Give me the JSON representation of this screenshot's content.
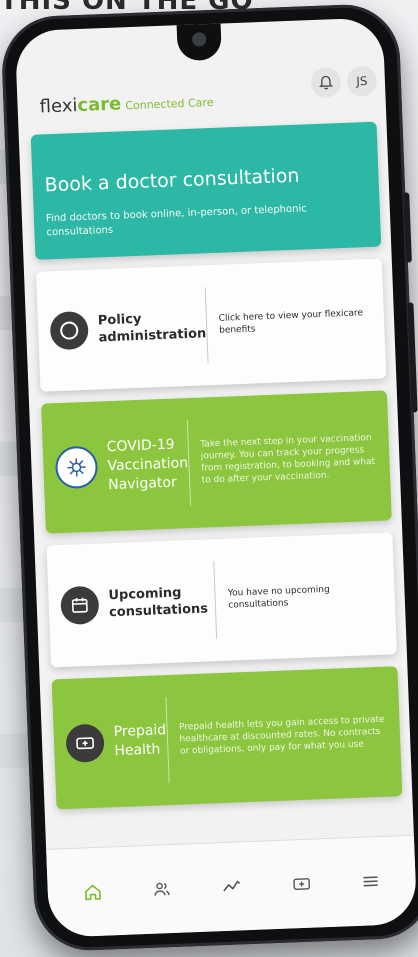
{
  "background": {
    "heading": "THIS ON THE GO"
  },
  "header": {
    "logo_prefix": "flexi",
    "logo_brand": "care",
    "logo_tagline": "Connected Care",
    "avatar_initials": "JS",
    "notification_icon": "bell-icon"
  },
  "hero": {
    "title": "Book a doctor consultation",
    "subtitle": "Find doctors to book online, in-person, or telephonic consultations"
  },
  "cards": [
    {
      "title": "Policy administration",
      "description": "Click here to view your flexicare benefits",
      "icon": "circle-icon",
      "style": "white"
    },
    {
      "title": "COVID-19 Vaccination Navigator",
      "description": "Take the next step in your vaccination journey. You can track your progress from registration, to booking and what to do after your vaccination.",
      "icon": "virus-icon",
      "style": "green"
    },
    {
      "title": "Upcoming consultations",
      "description": "You have no upcoming consultations",
      "icon": "calendar-icon",
      "style": "white"
    },
    {
      "title": "Prepaid Health",
      "description": "Prepaid health lets you gain access to private healthcare at discounted rates. No contracts or obligations, only pay for what you use",
      "icon": "health-card-icon",
      "style": "green"
    }
  ],
  "bottom_nav": [
    {
      "name": "home",
      "icon": "home-icon",
      "active": true
    },
    {
      "name": "people",
      "icon": "people-icon",
      "active": false
    },
    {
      "name": "activity",
      "icon": "activity-icon",
      "active": false
    },
    {
      "name": "health-card",
      "icon": "health-card-icon",
      "active": false
    },
    {
      "name": "menu",
      "icon": "menu-icon",
      "active": false
    }
  ],
  "colors": {
    "teal": "#2cb8a5",
    "green": "#8cc63f",
    "brand_green": "#7bbd2e",
    "dark_icon": "#3b3b3b"
  }
}
